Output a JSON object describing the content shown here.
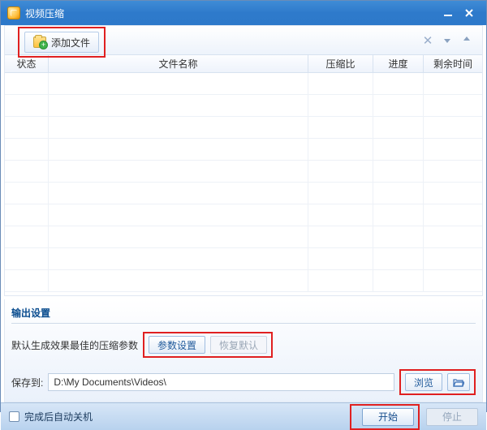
{
  "window": {
    "title": "视频压缩"
  },
  "toolbar": {
    "add_label": "添加文件"
  },
  "table": {
    "headers": {
      "status": "状态",
      "name": "文件名称",
      "ratio": "压缩比",
      "progress": "进度",
      "time": "剩余时间"
    },
    "rows": []
  },
  "output": {
    "section_title": "输出设置",
    "param_hint": "默认生成效果最佳的压缩参数",
    "param_settings_label": "参数设置",
    "restore_default_label": "恢复默认",
    "save_to_label": "保存到:",
    "save_path": "D:\\My Documents\\Videos\\",
    "browse_label": "浏览"
  },
  "footer": {
    "shutdown_label": "完成后自动关机",
    "start_label": "开始",
    "stop_label": "停止"
  }
}
